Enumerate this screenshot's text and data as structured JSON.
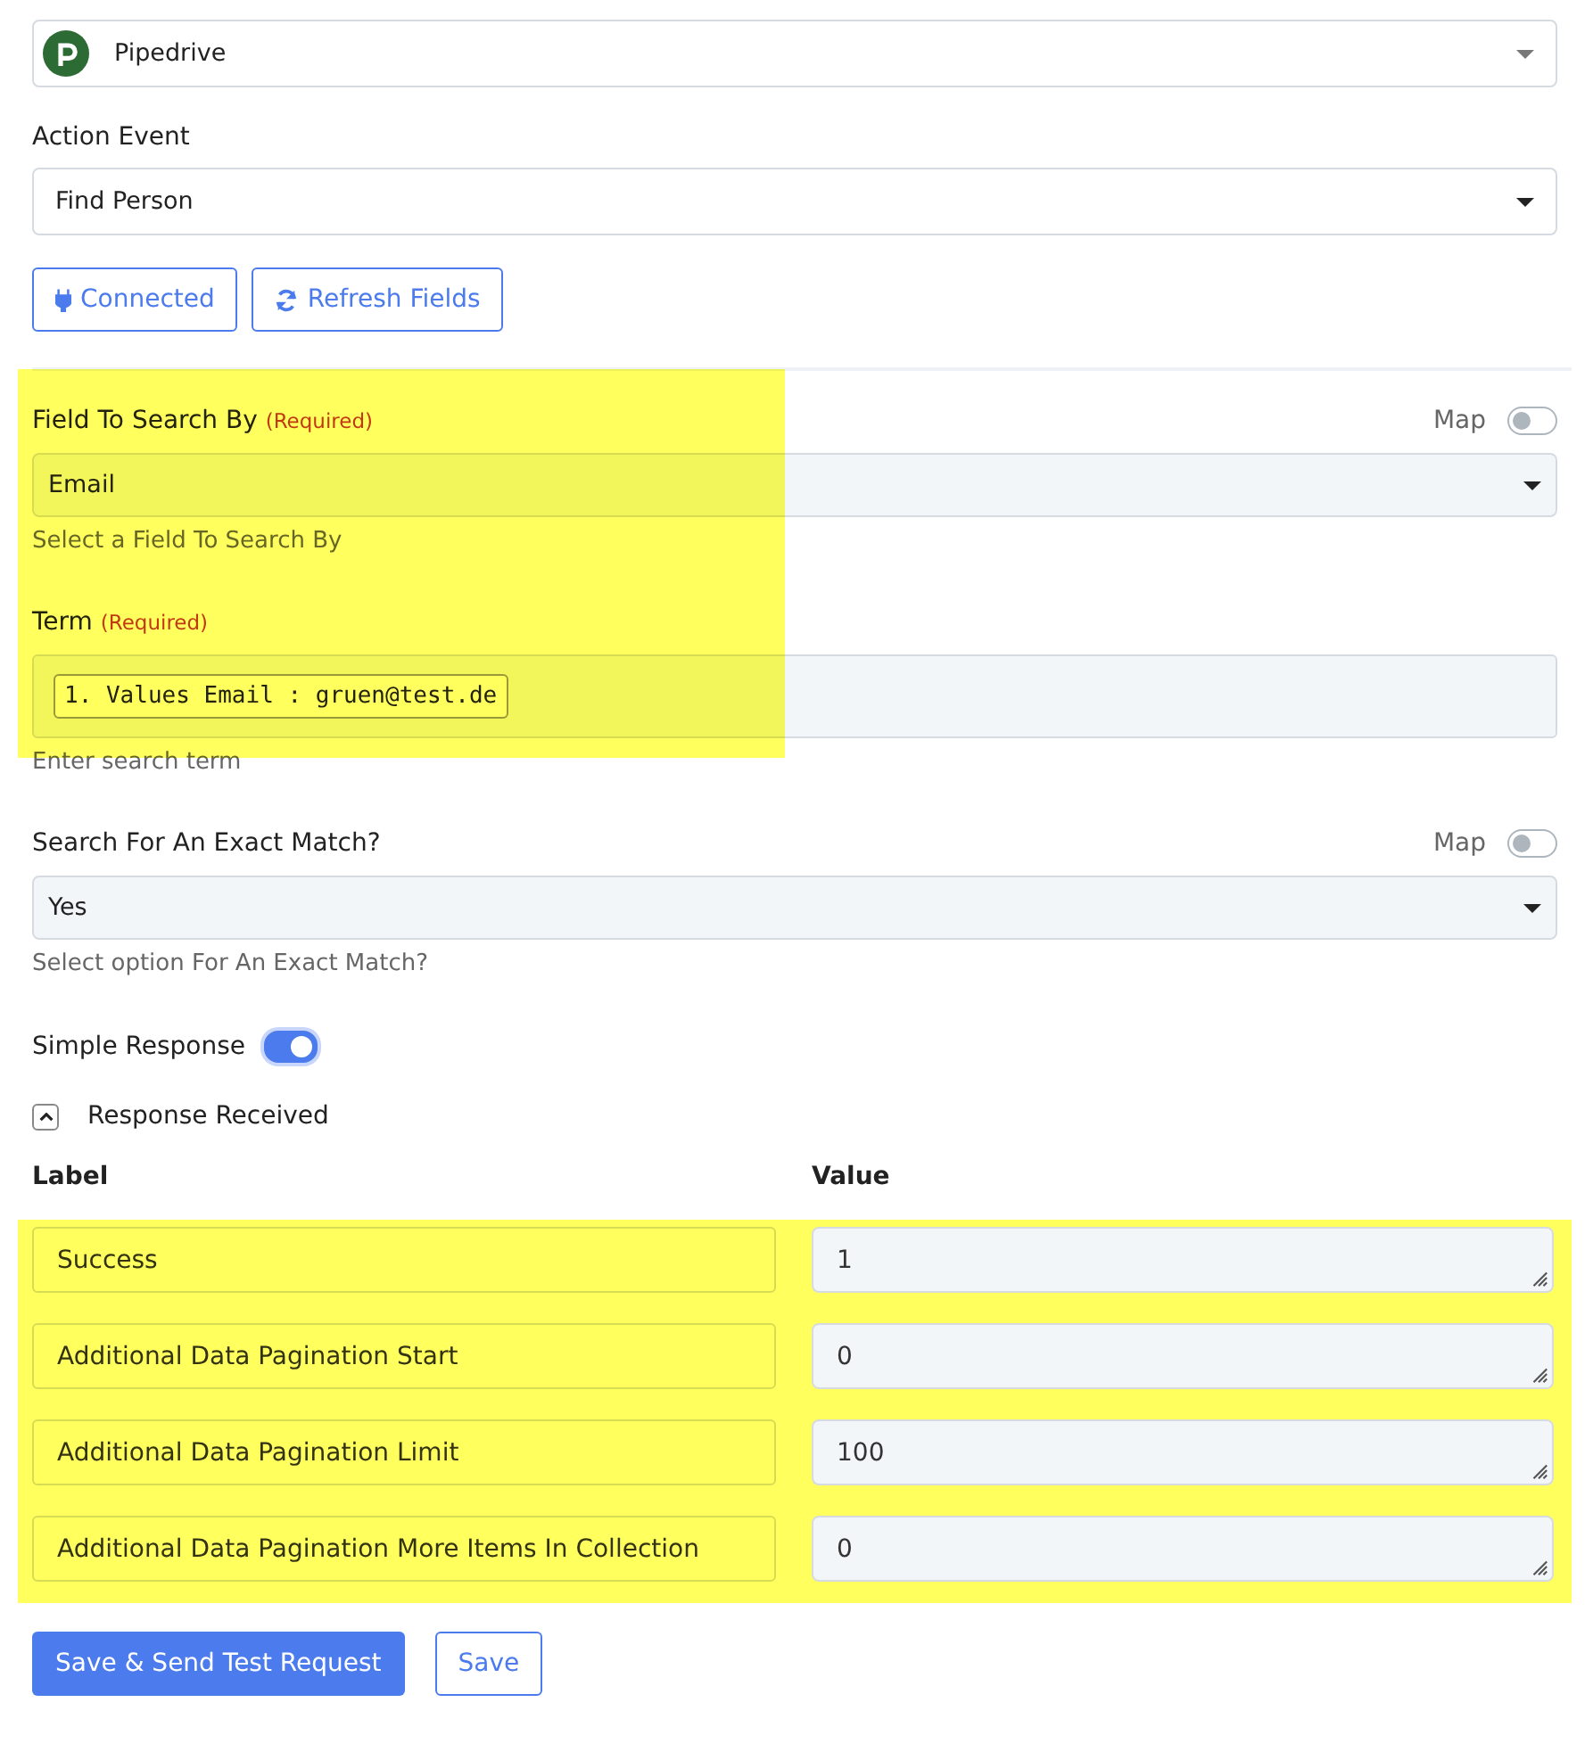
{
  "app_select": {
    "value": "Pipedrive"
  },
  "action_event": {
    "label": "Action Event",
    "value": "Find Person"
  },
  "buttons": [
    {
      "label": "Connected",
      "kind": "plug"
    },
    {
      "label": "Refresh Fields",
      "kind": "refresh"
    }
  ],
  "fields": [
    {
      "label": "Field To Search By",
      "required": "(Required)",
      "map_label": "Map",
      "map_on": false,
      "kind": "select",
      "value": "Email",
      "help": "Select a Field To Search By"
    },
    {
      "label": "Term",
      "required": "(Required)",
      "kind": "token",
      "value": "1. Values Email : gruen@test.de",
      "help": "Enter search term"
    },
    {
      "label": "Search For An Exact Match?",
      "map_label": "Map",
      "map_on": false,
      "kind": "select",
      "value": "Yes",
      "help": "Select option For An Exact Match?"
    }
  ],
  "simple_response": {
    "label": "Simple Response",
    "on": true
  },
  "response": {
    "title": "Response Received",
    "expanded": true,
    "columns": [
      "Label",
      "Value"
    ],
    "rows": [
      {
        "label": "Success",
        "value": "1"
      },
      {
        "label": "Additional Data Pagination Start",
        "value": "0"
      },
      {
        "label": "Additional Data Pagination Limit",
        "value": "100"
      },
      {
        "label": "Additional Data Pagination More Items In Collection",
        "value": "0"
      }
    ]
  },
  "actions": [
    {
      "label": "Save & Send Test Request",
      "kind": "primary"
    },
    {
      "label": "Save",
      "kind": "outline"
    }
  ]
}
